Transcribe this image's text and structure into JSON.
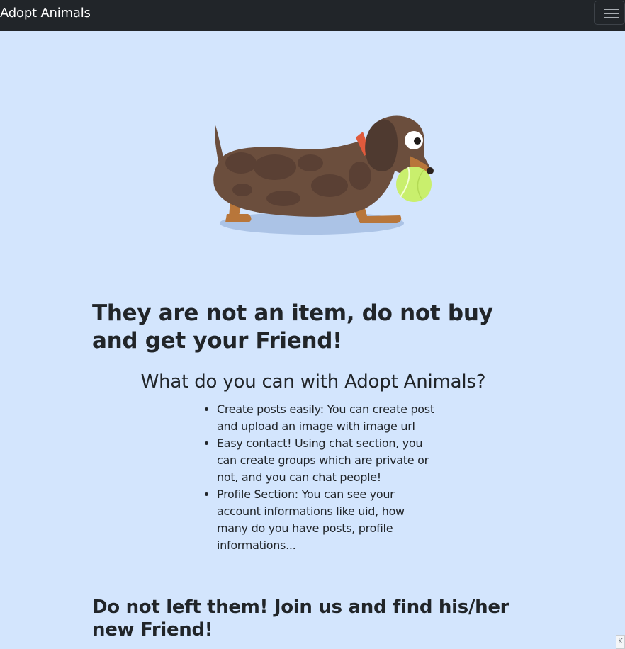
{
  "navbar": {
    "brand": "Adopt Animals",
    "toggler_icon": "hamburger-menu-icon"
  },
  "hero": {
    "illustration": "dachshund-with-tennis-ball",
    "colors": {
      "background": "#d3e5fd",
      "dog_body": "#6b4e3d",
      "dog_spots": "#5a4034",
      "dog_legs": "#b8763a",
      "ball": "#c9ef6d",
      "collar": "#e05a3c",
      "shadow": "#abc3e6"
    }
  },
  "main": {
    "heading": "They are not an item, do not buy and get your Friend!",
    "subheading": "What do you can with Adopt Animals?",
    "features": [
      "Create posts easily: You can create post and upload an image with image url",
      "Easy contact! Using chat section, you can create groups which are private or not, and you can chat people!",
      "Profile Section: You can see your account informations like uid, how many do you have posts, profile informations..."
    ],
    "closing": "Do not left them! Join us and find his/her new Friend!"
  },
  "corner_chip": {
    "label": "K"
  }
}
